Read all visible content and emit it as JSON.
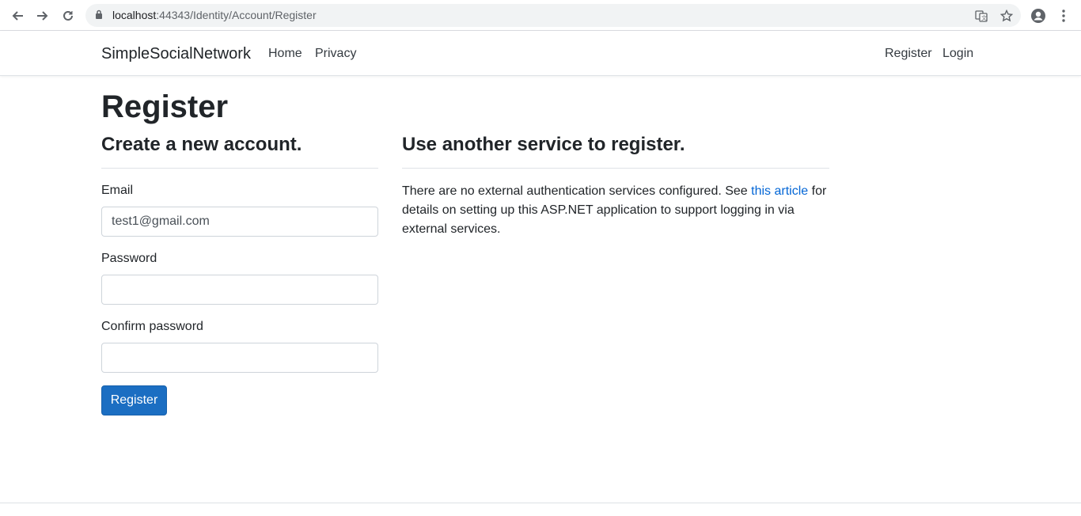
{
  "browser": {
    "url_host": "localhost",
    "url_rest": ":44343/Identity/Account/Register",
    "icons": [
      "back-arrow-icon",
      "forward-arrow-icon",
      "reload-icon",
      "lock-icon",
      "translate-icon",
      "star-icon",
      "account-icon",
      "menu-dots-icon"
    ]
  },
  "navbar": {
    "brand": "SimpleSocialNetwork",
    "links": [
      "Home",
      "Privacy"
    ],
    "right_links": [
      "Register",
      "Login"
    ]
  },
  "page": {
    "title": "Register",
    "left": {
      "heading": "Create a new account.",
      "email_label": "Email",
      "email_value": "test1@gmail.com",
      "password_label": "Password",
      "confirm_label": "Confirm password",
      "submit": "Register"
    },
    "right": {
      "heading": "Use another service to register.",
      "text_before": "There are no external authentication services configured. See ",
      "link": "this article",
      "text_after": " for details on setting up this ASP.NET application to support logging in via external services."
    }
  },
  "colors": {
    "primary_button": "#1b6ec2",
    "link": "#0366d6"
  }
}
